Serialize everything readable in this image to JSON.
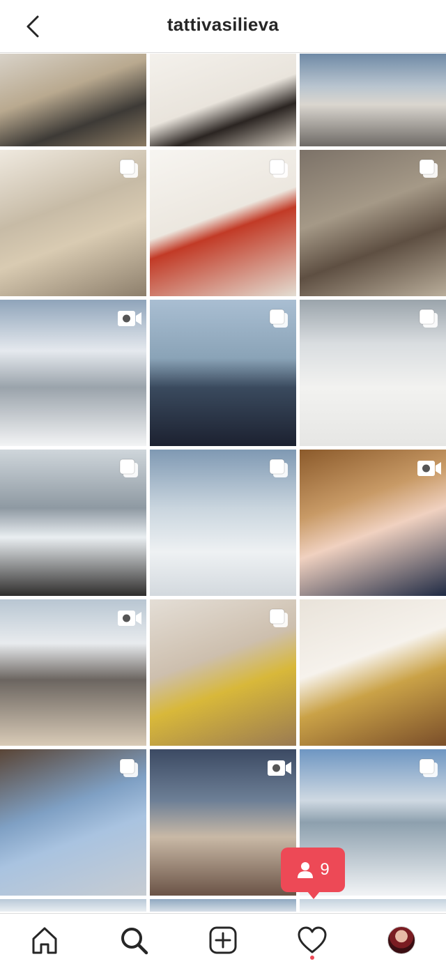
{
  "header": {
    "username": "tattivasilieva"
  },
  "tiles": [
    {
      "type": "photo",
      "bg": "linear-gradient(160deg,#d8d2c8 0%,#b9a98f 40%,#3d3a36 70%,#8a7a63 100%)"
    },
    {
      "type": "photo",
      "bg": "linear-gradient(160deg,#f4f1ec 0%,#e9e4dc 50%,#2b2522 70%,#cfc7bb 100%)"
    },
    {
      "type": "photo",
      "bg": "linear-gradient(180deg,#6f8aa6 0%,#b8c4cf 35%,#dad6cf 55%,#6e6a66 100%)"
    },
    {
      "type": "multiple",
      "bg": "linear-gradient(160deg,#efe9df 0%,#c7bba6 40%,#d9cbb2 60%,#8d7f6c 100%)"
    },
    {
      "type": "multiple",
      "bg": "linear-gradient(160deg,#f7f5f1 0%,#ece7df 45%,#c23a26 55%,#e3ddd2 100%)"
    },
    {
      "type": "multiple",
      "bg": "linear-gradient(160deg,#7c7268 0%,#a59987 40%,#5e4f42 65%,#b9ad9a 100%)"
    },
    {
      "type": "video",
      "bg": "linear-gradient(180deg,#8fa4ba 0%,#e5e9ee 35%,#9aa3ab 60%,#f3f4f5 100%)"
    },
    {
      "type": "multiple",
      "bg": "linear-gradient(180deg,#a9bed2 0%,#8aa3b7 40%,#3a4a5e 60%,#1c2130 100%)"
    },
    {
      "type": "multiple",
      "bg": "linear-gradient(180deg,#9aa4ab 0%,#d9dde0 30%,#f2f2f0 60%,#e6e6e4 100%)"
    },
    {
      "type": "multiple",
      "bg": "linear-gradient(180deg,#cfd6db 0%,#8e99a2 40%,#e9eef1 60%,#2f2d2c 100%)"
    },
    {
      "type": "multiple",
      "bg": "linear-gradient(180deg,#7f99b3 0%,#c9d5de 40%,#eef1f3 70%,#d3d9de 100%)"
    },
    {
      "type": "video",
      "bg": "linear-gradient(160deg,#8b5a2b 0%,#c89a66 35%,#f0d1c0 55%,#1f2a44 100%)"
    },
    {
      "type": "video",
      "bg": "linear-gradient(180deg,#b8c6d2 0%,#e8ebee 30%,#6b6560 55%,#d9cbb7 100%)"
    },
    {
      "type": "multiple",
      "bg": "linear-gradient(160deg,#e4ded6 0%,#cdbfae 40%,#d8b83a 60%,#9a7a52 100%)"
    },
    {
      "type": "photo",
      "bg": "linear-gradient(160deg,#e9e3da 0%,#f6f2ec 40%,#caa247 60%,#7a4e2a 100%)"
    },
    {
      "type": "multiple",
      "bg": "linear-gradient(160deg,#5a4536 0%,#7fa0c4 40%,#a9c3e0 60%,#c7ccd2 100%)"
    },
    {
      "type": "video",
      "bg": "linear-gradient(180deg,#3c4a63 0%,#6d7f96 35%,#c9b9a6 60%,#6a5346 100%)"
    },
    {
      "type": "multiple",
      "bg": "linear-gradient(180deg,#6e96c2 0%,#cfd9e2 35%,#8da0ae 50%,#f2f4f6 100%)"
    },
    {
      "type": "short",
      "bg": "linear-gradient(180deg,#b9c9d8,#e9eef2)"
    },
    {
      "type": "short",
      "bg": "linear-gradient(180deg,#8fa8c0,#d6dfe7)"
    },
    {
      "type": "short",
      "bg": "linear-gradient(180deg,#c4d2de,#eef2f5)"
    }
  ],
  "notification": {
    "count": "9"
  },
  "tabs": [
    "home-icon",
    "search-icon",
    "new-post-icon",
    "activity-heart-icon",
    "profile-avatar"
  ]
}
